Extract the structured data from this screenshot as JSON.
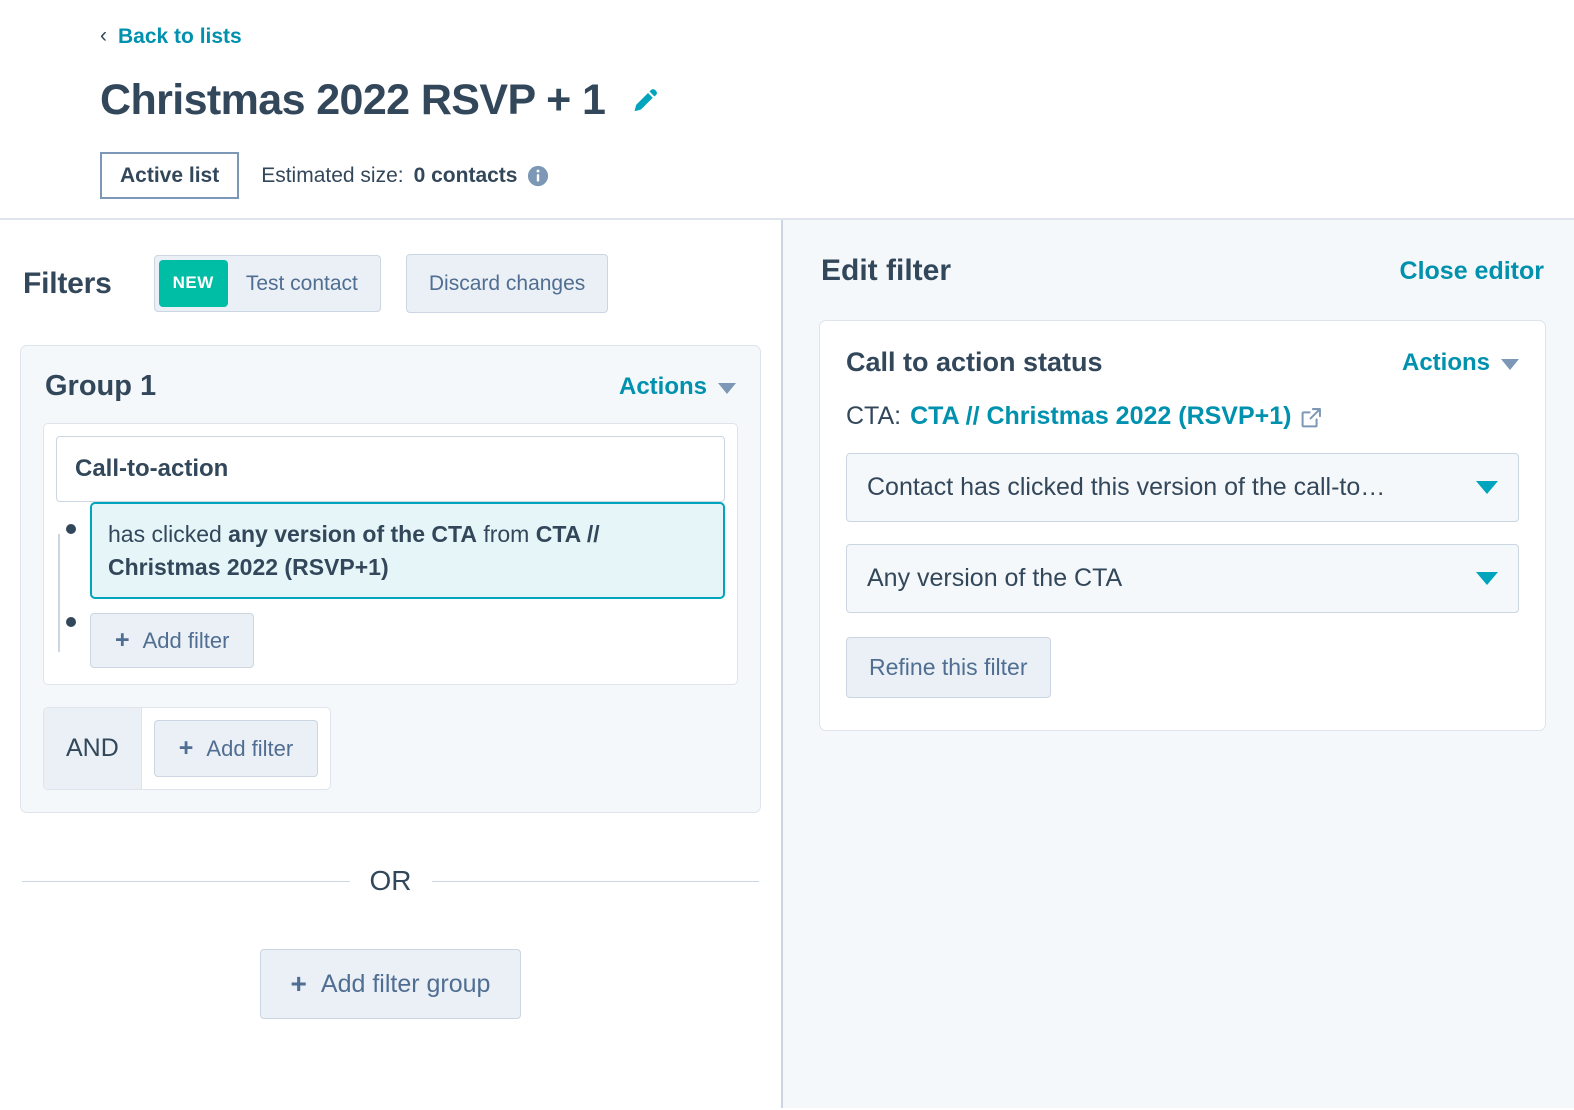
{
  "header": {
    "back_link": "Back to lists",
    "back_icon": "chevron-left-icon",
    "title": "Christmas 2022 RSVP + 1",
    "edit_icon": "pencil-icon",
    "list_type_badge": "Active list",
    "estimated_size_label": "Estimated size:",
    "estimated_size_value": "0 contacts",
    "info_icon": "info-circle-icon"
  },
  "filters_panel": {
    "title": "Filters",
    "test_contact": {
      "badge": "NEW",
      "label": "Test contact"
    },
    "discard_label": "Discard changes",
    "group": {
      "title": "Group 1",
      "actions_label": "Actions",
      "property": "Call-to-action",
      "filter_text": {
        "part1": "has clicked ",
        "bold1": "any version of the CTA",
        "part2": " from ",
        "bold2": "CTA // Christmas 2022 (RSVP+1)"
      },
      "add_filter_label": "Add filter",
      "plus": "+"
    },
    "and_label": "AND",
    "and_add_filter_label": "Add filter",
    "or_label": "OR",
    "add_filter_group_label": "Add filter group"
  },
  "editor_panel": {
    "title": "Edit filter",
    "close_label": "Close editor",
    "card": {
      "title": "Call to action status",
      "actions_label": "Actions",
      "cta_prefix": "CTA:",
      "cta_name": "CTA // Christmas 2022 (RSVP+1)",
      "external_icon": "external-link-icon",
      "select_event": "Contact has clicked this version of the call-to…",
      "select_version": "Any version of the CTA",
      "refine_label": "Refine this filter"
    }
  },
  "colors": {
    "teal_link": "#0091ae",
    "teal_accent": "#00a4bd",
    "new_badge_green": "#00bda5",
    "text_dark": "#33475b",
    "panel_bg": "#f5f8fa",
    "border": "#cbd6e2",
    "chip_bg": "#e5f5f8"
  }
}
